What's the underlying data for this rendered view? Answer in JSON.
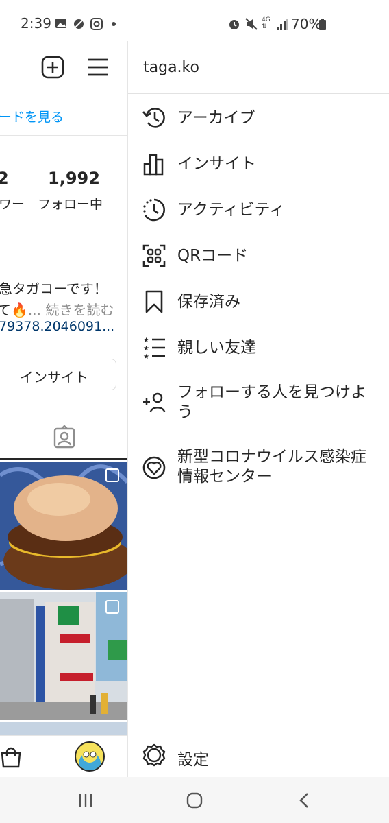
{
  "status_bar": {
    "time": "2:39",
    "battery": "70%",
    "network": "4G",
    "icons": [
      "gallery-icon",
      "weather-icon",
      "instagram-icon",
      "dot-icon",
      "alarm-icon",
      "mute-icon",
      "network-4g-icon",
      "signal-icon",
      "battery-icon"
    ]
  },
  "profile_partial": {
    "feed_link": "ードを見る",
    "followers_value": "2",
    "followers_label": "ワー",
    "following_value": "1,992",
    "following_label": "フォロー中",
    "bio_line1": "急タガコーです！",
    "bio_line2_prefix": "て🔥",
    "bio_more": "... 続きを読む",
    "bio_link": "79378.2046091...",
    "insight_button": "インサイト",
    "icons": [
      "new-post-icon",
      "menu-icon",
      "tagged-icon",
      "shopping-bag-icon",
      "avatar"
    ]
  },
  "drawer": {
    "username": "taga.ko",
    "items": [
      {
        "label": "アーカイブ",
        "icon": "archive-icon"
      },
      {
        "label": "インサイト",
        "icon": "insights-icon"
      },
      {
        "label": "アクティビティ",
        "icon": "activity-icon"
      },
      {
        "label": "QRコード",
        "icon": "qr-code-icon"
      },
      {
        "label": "保存済み",
        "icon": "saved-icon"
      },
      {
        "label": "親しい友達",
        "icon": "close-friends-icon"
      },
      {
        "label": "フォローする人を見つけよう",
        "icon": "discover-people-icon"
      },
      {
        "label": "新型コロナウイルス感染症情報センター",
        "icon": "covid-info-icon"
      }
    ],
    "settings_label": "設定",
    "settings_icon": "settings-icon"
  },
  "nav_bar": {
    "icons": [
      "recent-apps-icon",
      "home-icon",
      "back-icon"
    ]
  },
  "colors": {
    "link": "#0095f6",
    "bio_link": "#00376b",
    "text": "#262626",
    "muted": "#8e8e8e"
  }
}
